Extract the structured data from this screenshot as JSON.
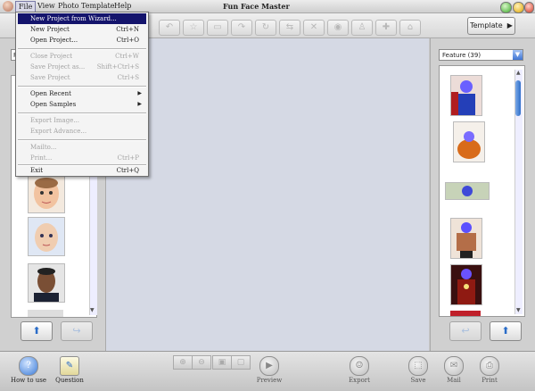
{
  "title_bar": {
    "app_title": "Fun Face Master",
    "menus": [
      "File",
      "View",
      "Photo",
      "Template",
      "Help"
    ]
  },
  "toolbar": {
    "template_button": "Template"
  },
  "file_menu": {
    "items": [
      {
        "label": "New Project from Wizard...",
        "shortcut": "",
        "disabled": false,
        "highlighted": true
      },
      {
        "label": "New Project",
        "shortcut": "Ctrl+N",
        "disabled": false
      },
      {
        "label": "Open Project...",
        "shortcut": "Ctrl+O",
        "disabled": false
      },
      {
        "label": "Close Project",
        "shortcut": "Ctrl+W",
        "disabled": true
      },
      {
        "label": "Save Project as...",
        "shortcut": "Shift+Ctrl+S",
        "disabled": true
      },
      {
        "label": "Save Project",
        "shortcut": "Ctrl+S",
        "disabled": true
      },
      {
        "label": "Open Recent",
        "shortcut": "",
        "disabled": false,
        "submenu": true
      },
      {
        "label": "Open Samples",
        "shortcut": "",
        "disabled": false,
        "submenu": true
      },
      {
        "label": "Export Image...",
        "shortcut": "",
        "disabled": true
      },
      {
        "label": "Export Advance...",
        "shortcut": "",
        "disabled": true
      },
      {
        "label": "Mailto...",
        "shortcut": "",
        "disabled": true
      },
      {
        "label": "Print...",
        "shortcut": "Ctrl+P",
        "disabled": true
      },
      {
        "label": "Exit",
        "shortcut": "Ctrl+Q",
        "disabled": false
      }
    ]
  },
  "left_panel": {
    "select_value": "F"
  },
  "right_panel": {
    "feature_select": "Feature (39)"
  },
  "bottom_bar": {
    "how_to_use": "How to use",
    "question": "Question",
    "preview": "Preview",
    "export": "Export",
    "save": "Save",
    "mail": "Mail",
    "print": "Print"
  },
  "colors": {
    "menu_highlight": "#14146c",
    "canvas": "#d5d9e4",
    "scroll_thumb": "#2f6fc9"
  }
}
